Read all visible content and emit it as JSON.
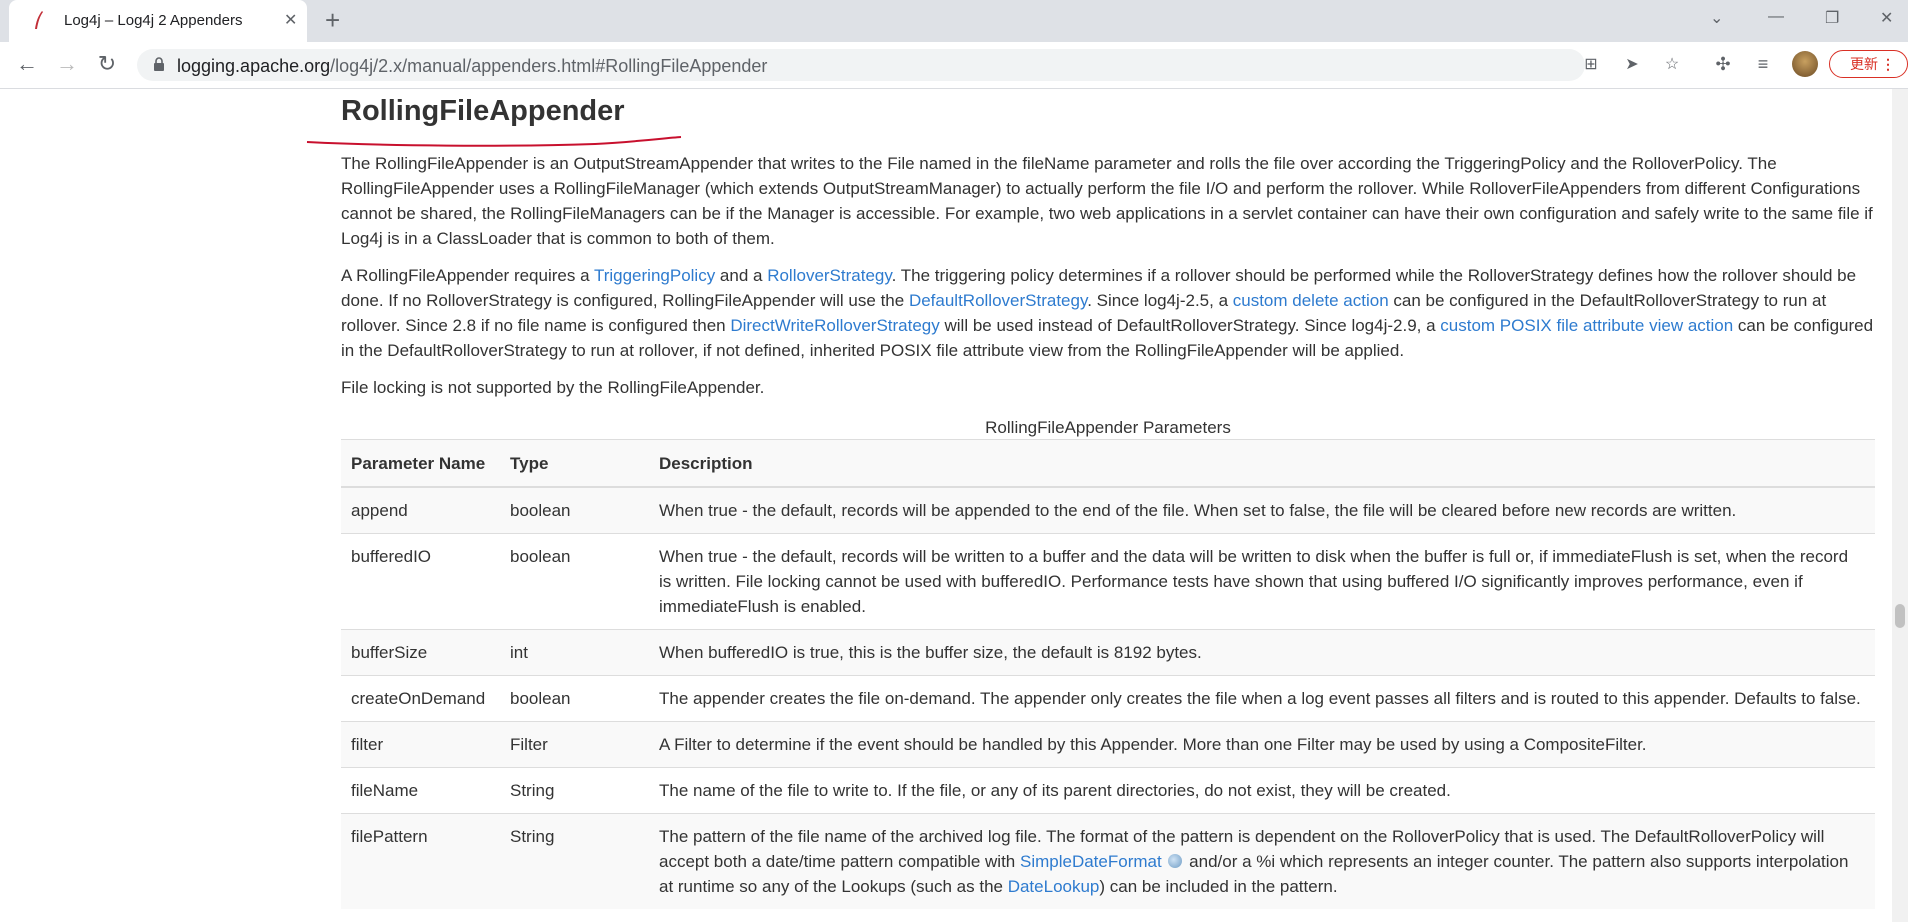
{
  "browser": {
    "tab_title": "Log4j – Log4j 2 Appenders",
    "url_host": "logging.apache.org",
    "url_path": "/log4j/2.x/manual/appenders.html#RollingFileAppender",
    "update_label": "更新"
  },
  "heading": "RollingFileAppender",
  "para1": "The RollingFileAppender is an OutputStreamAppender that writes to the File named in the fileName parameter and rolls the file over according the TriggeringPolicy and the RolloverPolicy. The RollingFileAppender uses a RollingFileManager (which extends OutputStreamManager) to actually perform the file I/O and perform the rollover. While RolloverFileAppenders from different Configurations cannot be shared, the RollingFileManagers can be if the Manager is accessible. For example, two web applications in a servlet container can have their own configuration and safely write to the same file if Log4j is in a ClassLoader that is common to both of them.",
  "para2": {
    "t1": "A RollingFileAppender requires a ",
    "l1": "TriggeringPolicy",
    "t2": " and a ",
    "l2": "RolloverStrategy",
    "t3": ". The triggering policy determines if a rollover should be performed while the RolloverStrategy defines how the rollover should be done. If no RolloverStrategy is configured, RollingFileAppender will use the ",
    "l3": "DefaultRolloverStrategy",
    "t4": ". Since log4j-2.5, a ",
    "l4": "custom delete action",
    "t5": " can be configured in the DefaultRolloverStrategy to run at rollover. Since 2.8 if no file name is configured then ",
    "l5": "DirectWriteRolloverStrategy",
    "t6": " will be used instead of DefaultRolloverStrategy. Since log4j-2.9, a ",
    "l6": "custom POSIX file attribute view action",
    "t7": " can be configured in the DefaultRolloverStrategy to run at rollover, if not defined, inherited POSIX file attribute view from the RollingFileAppender will be applied."
  },
  "para3": "File locking is not supported by the RollingFileAppender.",
  "table": {
    "caption": "RollingFileAppender Parameters",
    "headers": [
      "Parameter Name",
      "Type",
      "Description"
    ],
    "rows": [
      [
        "append",
        "boolean",
        "When true - the default, records will be appended to the end of the file. When set to false, the file will be cleared before new records are written."
      ],
      [
        "bufferedIO",
        "boolean",
        "When true - the default, records will be written to a buffer and the data will be written to disk when the buffer is full or, if immediateFlush is set, when the record is written. File locking cannot be used with bufferedIO. Performance tests have shown that using buffered I/O significantly improves performance, even if immediateFlush is enabled."
      ],
      [
        "bufferSize",
        "int",
        "When bufferedIO is true, this is the buffer size, the default is 8192 bytes."
      ],
      [
        "createOnDemand",
        "boolean",
        "The appender creates the file on-demand. The appender only creates the file when a log event passes all filters and is routed to this appender. Defaults to false."
      ],
      [
        "filter",
        "Filter",
        "A Filter to determine if the event should be handled by this Appender. More than one Filter may be used by using a CompositeFilter."
      ],
      [
        "fileName",
        "String",
        "The name of the file to write to. If the file, or any of its parent directories, do not exist, they will be created."
      ],
      [
        "filePattern",
        "String",
        ""
      ]
    ],
    "filePattern_desc": {
      "t1": "The pattern of the file name of the archived log file. The format of the pattern is dependent on the RolloverPolicy that is used. The DefaultRolloverPolicy will accept both a date/time pattern compatible with ",
      "l1": "SimpleDateFormat",
      "t2": " and/or a %i which represents an integer counter. The pattern also supports interpolation at runtime so any of the Lookups (such as the ",
      "l2": "DateLookup",
      "t3": ") can be included in the pattern."
    }
  }
}
